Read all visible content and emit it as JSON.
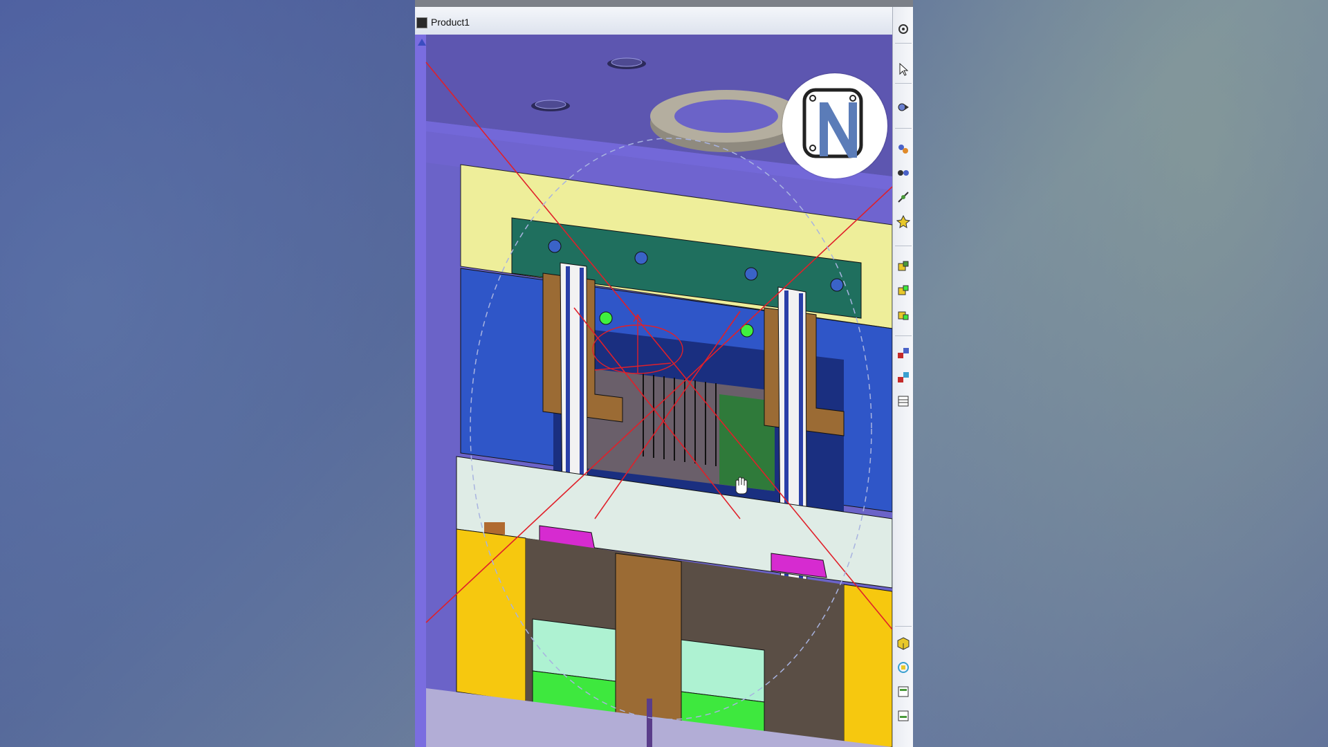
{
  "window": {
    "title": "Product1"
  },
  "viewport": {
    "background_color": "#6b63c8",
    "cursor": "hand-cursor"
  },
  "logo": {
    "name": "n-logo-watermark",
    "color": "#5b7cb8"
  },
  "toolbar": {
    "tools": [
      {
        "name": "options-tool-icon"
      },
      {
        "name": "select-arrow-icon"
      },
      {
        "name": "snap-tool-icon"
      },
      {
        "name": "assembly-tool-icon"
      },
      {
        "name": "constraint-tool-icon"
      },
      {
        "name": "axis-tool-icon"
      },
      {
        "name": "explode-tool-icon"
      },
      {
        "name": "insert-component-icon"
      },
      {
        "name": "insert-existing-icon"
      },
      {
        "name": "insert-new-part-icon"
      },
      {
        "name": "move-tool-icon"
      },
      {
        "name": "manipulate-tool-icon"
      },
      {
        "name": "table-tool-icon"
      },
      {
        "name": "cube-tool-icon"
      },
      {
        "name": "analysis-tool-icon"
      },
      {
        "name": "catalog-tool-icon"
      },
      {
        "name": "catalog-browser-icon"
      }
    ]
  }
}
